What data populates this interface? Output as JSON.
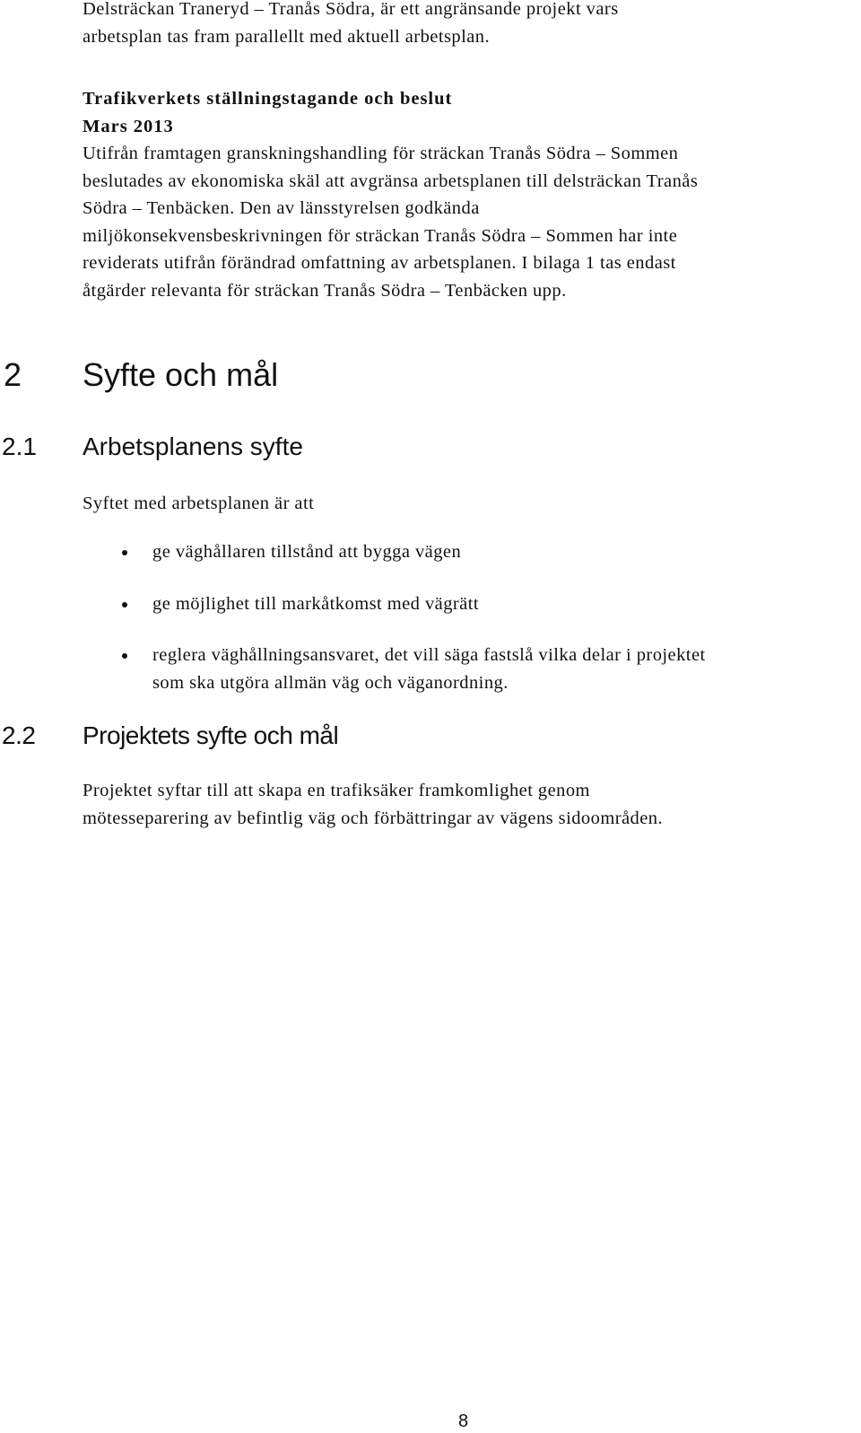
{
  "intro": {
    "lines": [
      "Delsträckan Traneryd – Tranås Södra, är ett angränsande projekt vars",
      "arbetsplan tas fram parallellt med aktuell arbetsplan."
    ]
  },
  "decision": {
    "heading": "Trafikverkets ställningstagande och beslut",
    "date": "Mars 2013",
    "lines": [
      "Utifrån framtagen granskningshandling för sträckan Tranås Södra – Sommen",
      "beslutades av ekonomiska skäl att avgränsa arbetsplanen till delsträckan Tranås",
      "Södra – Tenbäcken. Den av länsstyrelsen godkända",
      "miljökonsekvensbeskrivningen för sträckan Tranås Södra – Sommen har inte",
      "reviderats utifrån förändrad omfattning av arbetsplanen. I bilaga 1 tas endast",
      "åtgärder relevanta för sträckan Tranås Södra – Tenbäcken upp."
    ]
  },
  "section2": {
    "number": "2",
    "title": "Syfte och mål"
  },
  "section2_1": {
    "number": "2.1",
    "title": "Arbetsplanens syfte",
    "intro": "Syftet med arbetsplanen är att",
    "bullets": [
      {
        "lines": [
          "ge väghållaren tillstånd att bygga vägen"
        ]
      },
      {
        "lines": [
          "ge möjlighet till markåtkomst med vägrätt"
        ]
      },
      {
        "lines": [
          "reglera väghållningsansvaret, det vill säga fastslå vilka delar i projektet",
          "som ska utgöra allmän väg och väganordning."
        ]
      }
    ]
  },
  "section2_2": {
    "number": "2.2",
    "title": "Projektets syfte och mål",
    "lines": [
      "Projektet syftar till att skapa en trafiksäker framkomlighet genom",
      "mötesseparering av befintlig väg och förbättringar av vägens sidoområden."
    ]
  },
  "footer": {
    "page_number": "8"
  }
}
